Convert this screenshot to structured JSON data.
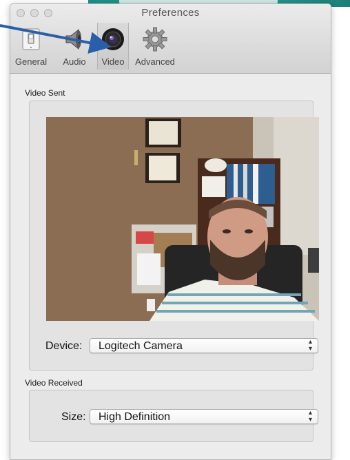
{
  "window": {
    "title": "Preferences"
  },
  "toolbar": {
    "tabs": [
      {
        "label": "General",
        "icon": "light-switch-icon"
      },
      {
        "label": "Audio",
        "icon": "speaker-icon"
      },
      {
        "label": "Video",
        "icon": "camera-lens-icon",
        "selected": true
      },
      {
        "label": "Advanced",
        "icon": "gear-icon"
      }
    ]
  },
  "video_sent": {
    "label": "Video Sent",
    "device_label": "Device:",
    "device_value": "Logitech Camera"
  },
  "video_received": {
    "label": "Video Received",
    "size_label": "Size:",
    "size_value": "High Definition"
  },
  "colors": {
    "window_bg": "#ececec",
    "annotation_arrow": "#2a5fa8"
  }
}
